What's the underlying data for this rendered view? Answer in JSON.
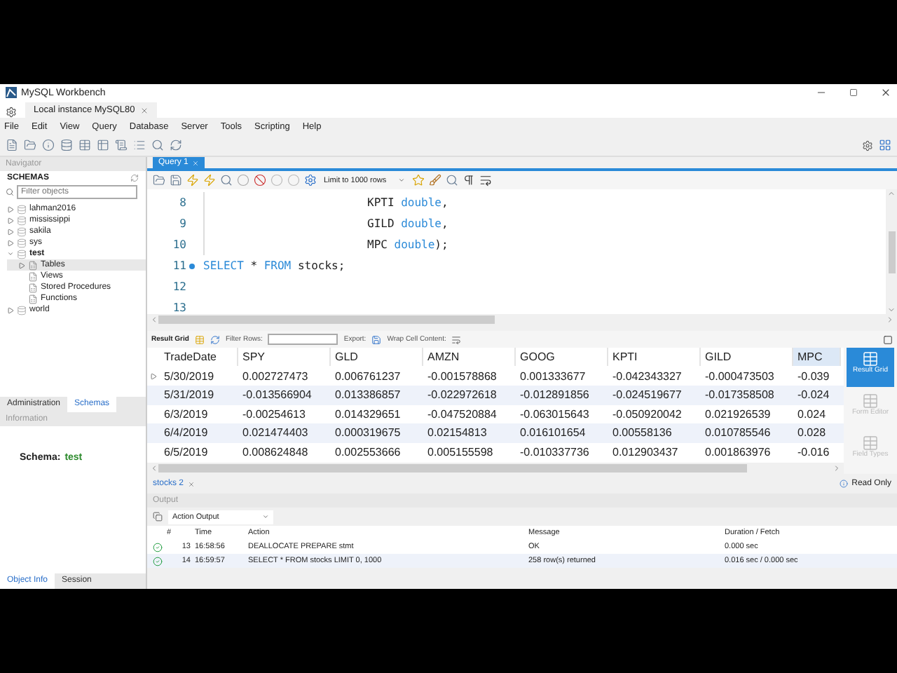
{
  "window": {
    "title": "MySQL Workbench"
  },
  "connection_tab": {
    "label": "Local instance MySQL80"
  },
  "menu": [
    "File",
    "Edit",
    "View",
    "Query",
    "Database",
    "Server",
    "Tools",
    "Scripting",
    "Help"
  ],
  "navigator": {
    "title": "Navigator",
    "section": "SCHEMAS",
    "filter_placeholder": "Filter objects",
    "schemas": [
      {
        "name": "lahman2016",
        "expanded": false
      },
      {
        "name": "mississippi",
        "expanded": false
      },
      {
        "name": "sakila",
        "expanded": false
      },
      {
        "name": "sys",
        "expanded": false
      },
      {
        "name": "test",
        "expanded": true,
        "children": [
          {
            "label": "Tables",
            "selected": true,
            "expandable": true
          },
          {
            "label": "Views",
            "selected": false,
            "expandable": false
          },
          {
            "label": "Stored Procedures",
            "selected": false,
            "expandable": false
          },
          {
            "label": "Functions",
            "selected": false,
            "expandable": false
          }
        ]
      },
      {
        "name": "world",
        "expanded": false
      }
    ]
  },
  "nav_tabs": [
    {
      "label": "Administration",
      "selected": false
    },
    {
      "label": "Schemas",
      "selected": true
    }
  ],
  "information": {
    "title": "Information",
    "label": "Schema:",
    "value": "test"
  },
  "info_tabs": [
    {
      "label": "Object Info",
      "selected": true
    },
    {
      "label": "Session",
      "selected": false
    }
  ],
  "query_tab": {
    "label": "Query 1"
  },
  "editor": {
    "limit": "Limit to 1000 rows",
    "lines": [
      {
        "number": "8",
        "marker": false,
        "indent": true,
        "tokens": [
          {
            "text": "KPTI ",
            "kind": "plain"
          },
          {
            "text": "double",
            "kind": "keyword"
          },
          {
            "text": ",",
            "kind": "plain"
          }
        ]
      },
      {
        "number": "9",
        "marker": false,
        "indent": true,
        "tokens": [
          {
            "text": "GILD ",
            "kind": "plain"
          },
          {
            "text": "double",
            "kind": "keyword"
          },
          {
            "text": ",",
            "kind": "plain"
          }
        ]
      },
      {
        "number": "10",
        "marker": false,
        "indent": true,
        "tokens": [
          {
            "text": "MPC ",
            "kind": "plain"
          },
          {
            "text": "double",
            "kind": "keyword"
          },
          {
            "text": ");",
            "kind": "plain"
          }
        ]
      },
      {
        "number": "11",
        "marker": true,
        "indent": false,
        "tokens": [
          {
            "text": "SELECT",
            "kind": "keyword"
          },
          {
            "text": " * ",
            "kind": "plain"
          },
          {
            "text": "FROM",
            "kind": "keyword"
          },
          {
            "text": " stocks;",
            "kind": "plain"
          }
        ]
      },
      {
        "number": "12",
        "marker": false,
        "indent": false
      },
      {
        "number": "13",
        "marker": false,
        "indent": false
      }
    ]
  },
  "result": {
    "toolbar": {
      "title": "Result Grid",
      "filter_label": "Filter Rows:",
      "export_label": "Export:",
      "wrap_label": "Wrap Cell Content:"
    },
    "columns": [
      "TradeDate",
      "SPY",
      "GLD",
      "AMZN",
      "GOOG",
      "KPTI",
      "GILD",
      "MPC"
    ],
    "rows": [
      {
        "current": true,
        "cells": [
          "5/30/2019",
          "0.002727473",
          "0.006761237",
          "-0.001578868",
          "0.001333677",
          "-0.042343327",
          "-0.000473503",
          "-0.039"
        ]
      },
      {
        "current": false,
        "cells": [
          "5/31/2019",
          "-0.013566904",
          "0.013386857",
          "-0.022972618",
          "-0.012891856",
          "-0.024519677",
          "-0.017358508",
          "-0.024"
        ]
      },
      {
        "current": false,
        "cells": [
          "6/3/2019",
          "-0.00254613",
          "0.014329651",
          "-0.047520884",
          "-0.063015643",
          "-0.050920042",
          "0.021926539",
          "0.024"
        ]
      },
      {
        "current": false,
        "cells": [
          "6/4/2019",
          "0.021474403",
          "0.000319675",
          "0.02154813",
          "0.016101654",
          "0.00558136",
          "0.010785546",
          "0.028"
        ]
      },
      {
        "current": false,
        "cells": [
          "6/5/2019",
          "0.008624848",
          "0.002553666",
          "0.005155598",
          "-0.010337736",
          "0.012903437",
          "0.001863976",
          "-0.016"
        ]
      }
    ],
    "side_panel": [
      {
        "label": "Result Grid",
        "selected": true
      },
      {
        "label": "Form Editor",
        "selected": false
      },
      {
        "label": "Field Types",
        "selected": false
      }
    ]
  },
  "result_tab": {
    "label": "stocks 2"
  },
  "status": "Read Only",
  "output": {
    "title": "Output",
    "mode": "Action Output",
    "columns": [
      "#",
      "Time",
      "Action",
      "Message",
      "Duration / Fetch"
    ],
    "rows": [
      {
        "selected": false,
        "number": "13",
        "time": "16:58:56",
        "action": "DEALLOCATE PREPARE stmt",
        "message": "OK",
        "duration": "0.000 sec"
      },
      {
        "selected": true,
        "number": "14",
        "time": "16:59:57",
        "action": "SELECT * FROM stocks LIMIT 0, 1000",
        "message": "258 row(s) returned",
        "duration": "0.016 sec / 0.000 sec"
      }
    ]
  }
}
